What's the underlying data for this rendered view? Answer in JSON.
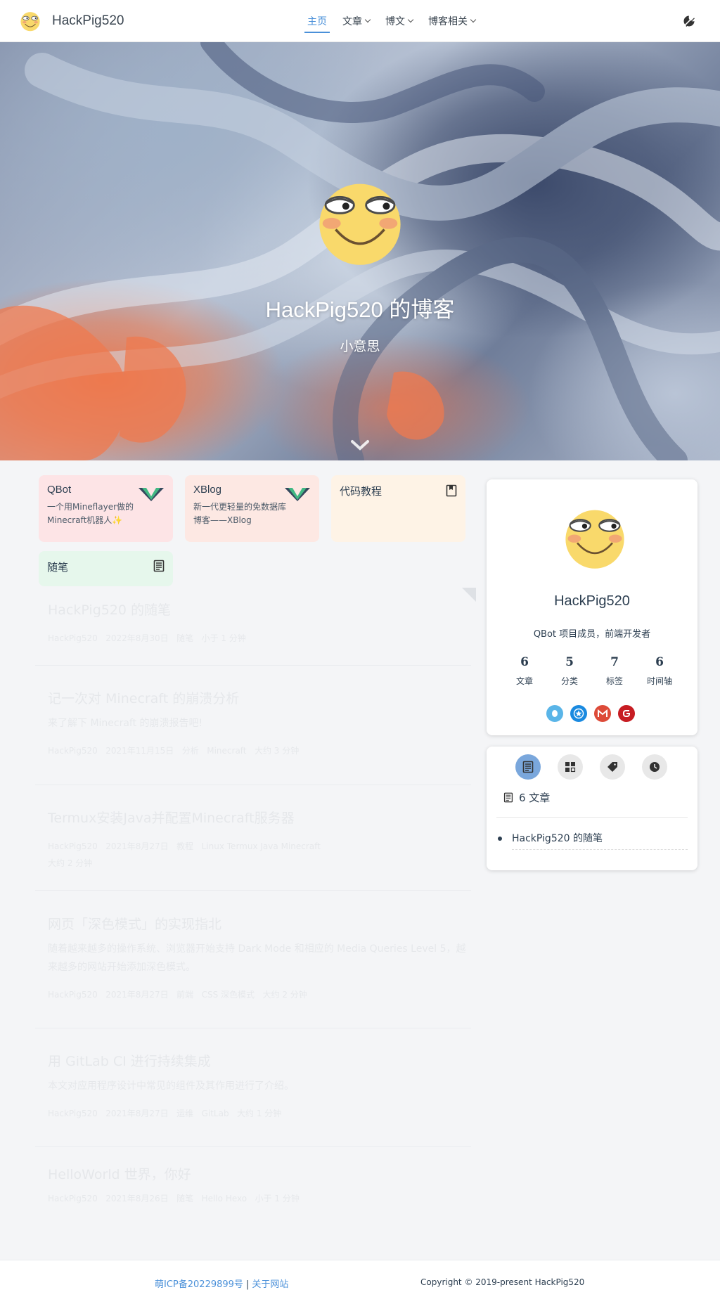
{
  "nav": {
    "brand": "HackPig520",
    "links": [
      {
        "label": "主页"
      },
      {
        "label": "文章"
      },
      {
        "label": "博文"
      },
      {
        "label": "博客相关"
      }
    ]
  },
  "hero": {
    "title": "HackPig520 的博客",
    "subtitle": "小意思"
  },
  "projects": [
    {
      "title": "QBot",
      "desc": "一个用Mineflayer做的Minecraft机器人✨",
      "bg": "#fde4e6",
      "icon": "vue-icon"
    },
    {
      "title": "XBlog",
      "desc": "新一代更轻量的免数据库博客——XBlog",
      "bg": "#fde8e3",
      "icon": "vue-icon"
    },
    {
      "title": "代码教程",
      "desc": "",
      "bg": "#fef3e6",
      "icon": "book-icon"
    },
    {
      "title": "随笔",
      "desc": "",
      "bg": "#e6f7ec",
      "icon": "article-icon"
    }
  ],
  "articles": [
    {
      "title": "HackPig520 的随笔",
      "excerpt": "",
      "meta": [
        "HackPig520",
        "2022年8月30日",
        "随笔",
        "小于 1 分钟"
      ]
    },
    {
      "title": "记一次对 Minecraft 的崩溃分析",
      "excerpt": "来了解下 Minecraft 的崩溃报告吧!",
      "meta": [
        "HackPig520",
        "2021年11月15日",
        "分析",
        "Minecraft",
        "大约 3 分钟"
      ]
    },
    {
      "title": "Termux安装Java并配置Minecraft服务器",
      "excerpt": "",
      "meta": [
        "HackPig520",
        "2021年8月27日",
        "教程",
        "Linux",
        "Termux",
        "Java",
        "Minecraft",
        "大约 2 分钟"
      ]
    },
    {
      "title": "网页「深色模式」的实现指北",
      "excerpt": "随着越来越多的操作系统、浏览器开始支持 Dark Mode 和相应的 Media Queries Level 5，越来越多的网站开始添加深色模式。",
      "meta": [
        "HackPig520",
        "2021年8月27日",
        "前端",
        "CSS",
        "深色模式",
        "大约 2 分钟"
      ]
    },
    {
      "title": "用 GitLab CI 进行持续集成",
      "excerpt": "本文对应用程序设计中常见的组件及其作用进行了介绍。",
      "meta": [
        "HackPig520",
        "2021年8月27日",
        "运维",
        "GitLab",
        "大约 1 分钟"
      ]
    },
    {
      "title": "HelloWorld 世界，你好",
      "excerpt": "",
      "meta": [
        "HackPig520",
        "2021年8月26日",
        "随笔",
        "Hello",
        "Hexo",
        "小于 1 分钟"
      ]
    }
  ],
  "profile": {
    "name": "HackPig520",
    "desc": "QBot 项目成员，前端开发者",
    "stats": [
      {
        "num": "6",
        "label": "文章"
      },
      {
        "num": "5",
        "label": "分类"
      },
      {
        "num": "7",
        "label": "标签"
      },
      {
        "num": "6",
        "label": "时间轴"
      }
    ],
    "socials": [
      {
        "name": "qq-icon",
        "color": "#5ab5e8"
      },
      {
        "name": "star-icon",
        "color": "#1a8ae0"
      },
      {
        "name": "gmail-icon",
        "color": "#dd4b39"
      },
      {
        "name": "gitee-icon",
        "color": "#c71d23"
      }
    ]
  },
  "info": {
    "heading": "6 文章",
    "item": "HackPig520 的随笔"
  },
  "footer": {
    "icp": "萌ICP备20229899号",
    "sep": "|",
    "about": "关于网站",
    "copyright": "Copyright © 2019-present HackPig520"
  }
}
